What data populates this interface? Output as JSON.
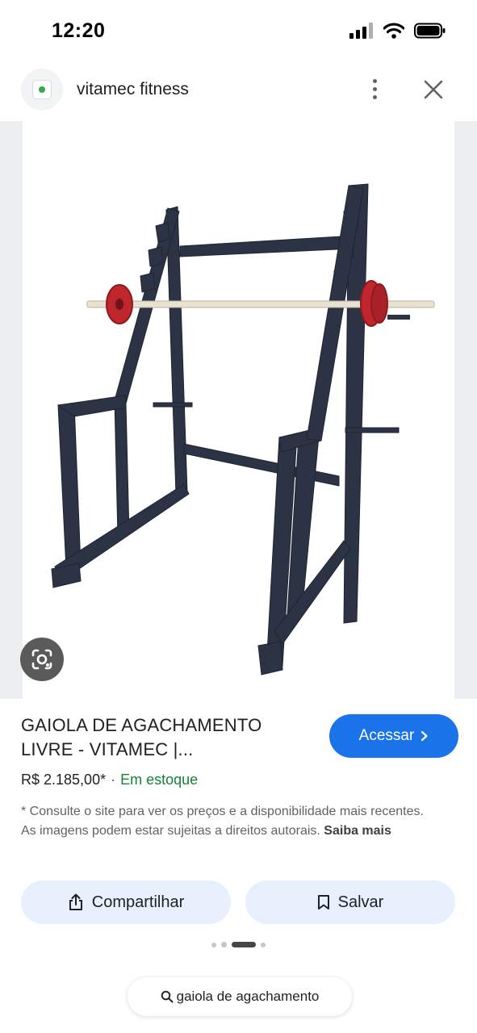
{
  "status_bar": {
    "time": "12:20",
    "icons": [
      "signal-icon",
      "wifi-icon",
      "battery-icon"
    ]
  },
  "header": {
    "site_name": "vitamec fitness",
    "icons": [
      "site-favicon-icon",
      "more-vert-icon",
      "close-icon"
    ]
  },
  "product": {
    "title": "GAIOLA DE AGACHAMENTO LIVRE - VITAMEC |...",
    "price": "R$ 2.185,00*",
    "separator": "·",
    "stock": "Em estoque",
    "visit_label": "Acessar",
    "visit_icon": "chevron-right-icon"
  },
  "disclaimer": {
    "text": "* Consulte o site para ver os preços e a disponibilidade mais recentes. As imagens podem estar sujeitas a direitos autorais. ",
    "learn_more": "Saiba mais"
  },
  "actions": {
    "share_label": "Compartilhar",
    "save_label": "Salvar"
  },
  "pager": {
    "count": 4,
    "active_index": 2
  },
  "search": {
    "query": "gaiola de agachamento",
    "icon": "search-icon"
  },
  "colors": {
    "accent": "#1a73e8",
    "in_stock": "#188038",
    "chip_bg": "#e8f0fe",
    "rack_frame": "#2b3344",
    "plate_red": "#c0272d"
  }
}
